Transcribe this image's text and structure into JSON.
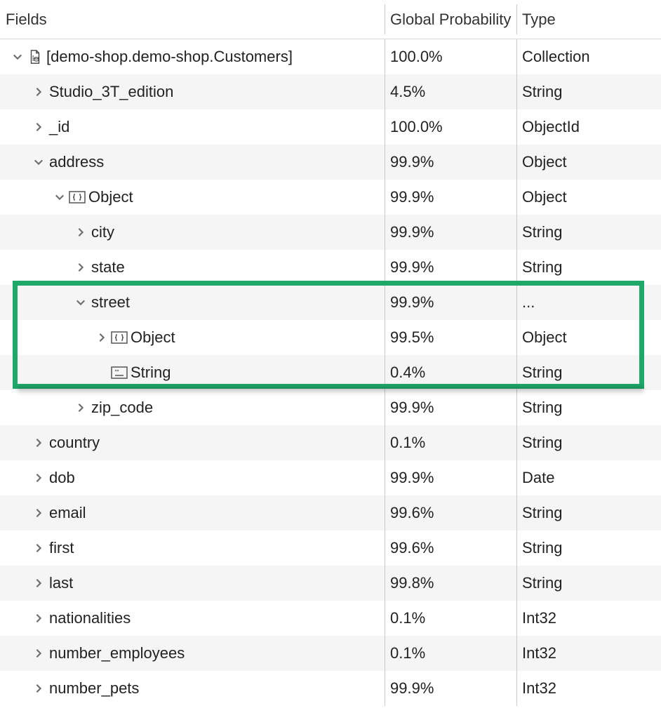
{
  "header": {
    "fields": "Fields",
    "prob": "Global Probability",
    "type": "Type"
  },
  "rows": [
    {
      "indent": 0,
      "chev": "down",
      "icon": "collection",
      "name": "[demo-shop.demo-shop.Customers]",
      "prob": "100.0%",
      "type": "Collection",
      "alt": false
    },
    {
      "indent": 1,
      "chev": "right",
      "icon": "",
      "name": "Studio_3T_edition",
      "prob": "4.5%",
      "type": "String",
      "alt": true
    },
    {
      "indent": 1,
      "chev": "right",
      "icon": "",
      "name": "_id",
      "prob": "100.0%",
      "type": "ObjectId",
      "alt": false
    },
    {
      "indent": 1,
      "chev": "down",
      "icon": "",
      "name": "address",
      "prob": "99.9%",
      "type": "Object",
      "alt": true
    },
    {
      "indent": 2,
      "chev": "down",
      "icon": "object",
      "name": "Object",
      "prob": "99.9%",
      "type": "Object",
      "alt": false
    },
    {
      "indent": 3,
      "chev": "right",
      "icon": "",
      "name": "city",
      "prob": "99.9%",
      "type": "String",
      "alt": true
    },
    {
      "indent": 3,
      "chev": "right",
      "icon": "",
      "name": "state",
      "prob": "99.9%",
      "type": "String",
      "alt": false
    },
    {
      "indent": 3,
      "chev": "down",
      "icon": "",
      "name": "street",
      "prob": "99.9%",
      "type": "...",
      "alt": true
    },
    {
      "indent": 4,
      "chev": "right",
      "icon": "object",
      "name": "Object",
      "prob": "99.5%",
      "type": "Object",
      "alt": false
    },
    {
      "indent": 4,
      "chev": "none",
      "icon": "string",
      "name": "String",
      "prob": "0.4%",
      "type": "String",
      "alt": true
    },
    {
      "indent": 3,
      "chev": "right",
      "icon": "",
      "name": "zip_code",
      "prob": "99.9%",
      "type": "String",
      "alt": false
    },
    {
      "indent": 1,
      "chev": "right",
      "icon": "",
      "name": "country",
      "prob": "0.1%",
      "type": "String",
      "alt": true
    },
    {
      "indent": 1,
      "chev": "right",
      "icon": "",
      "name": "dob",
      "prob": "99.9%",
      "type": "Date",
      "alt": false
    },
    {
      "indent": 1,
      "chev": "right",
      "icon": "",
      "name": "email",
      "prob": "99.6%",
      "type": "String",
      "alt": true
    },
    {
      "indent": 1,
      "chev": "right",
      "icon": "",
      "name": "first",
      "prob": "99.6%",
      "type": "String",
      "alt": false
    },
    {
      "indent": 1,
      "chev": "right",
      "icon": "",
      "name": "last",
      "prob": "99.8%",
      "type": "String",
      "alt": true
    },
    {
      "indent": 1,
      "chev": "right",
      "icon": "",
      "name": "nationalities",
      "prob": "0.1%",
      "type": "Int32",
      "alt": false
    },
    {
      "indent": 1,
      "chev": "right",
      "icon": "",
      "name": "number_employees",
      "prob": "0.1%",
      "type": "Int32",
      "alt": true
    },
    {
      "indent": 1,
      "chev": "right",
      "icon": "",
      "name": "number_pets",
      "prob": "99.9%",
      "type": "Int32",
      "alt": false
    }
  ],
  "highlight": {
    "start": 7,
    "end": 9
  }
}
